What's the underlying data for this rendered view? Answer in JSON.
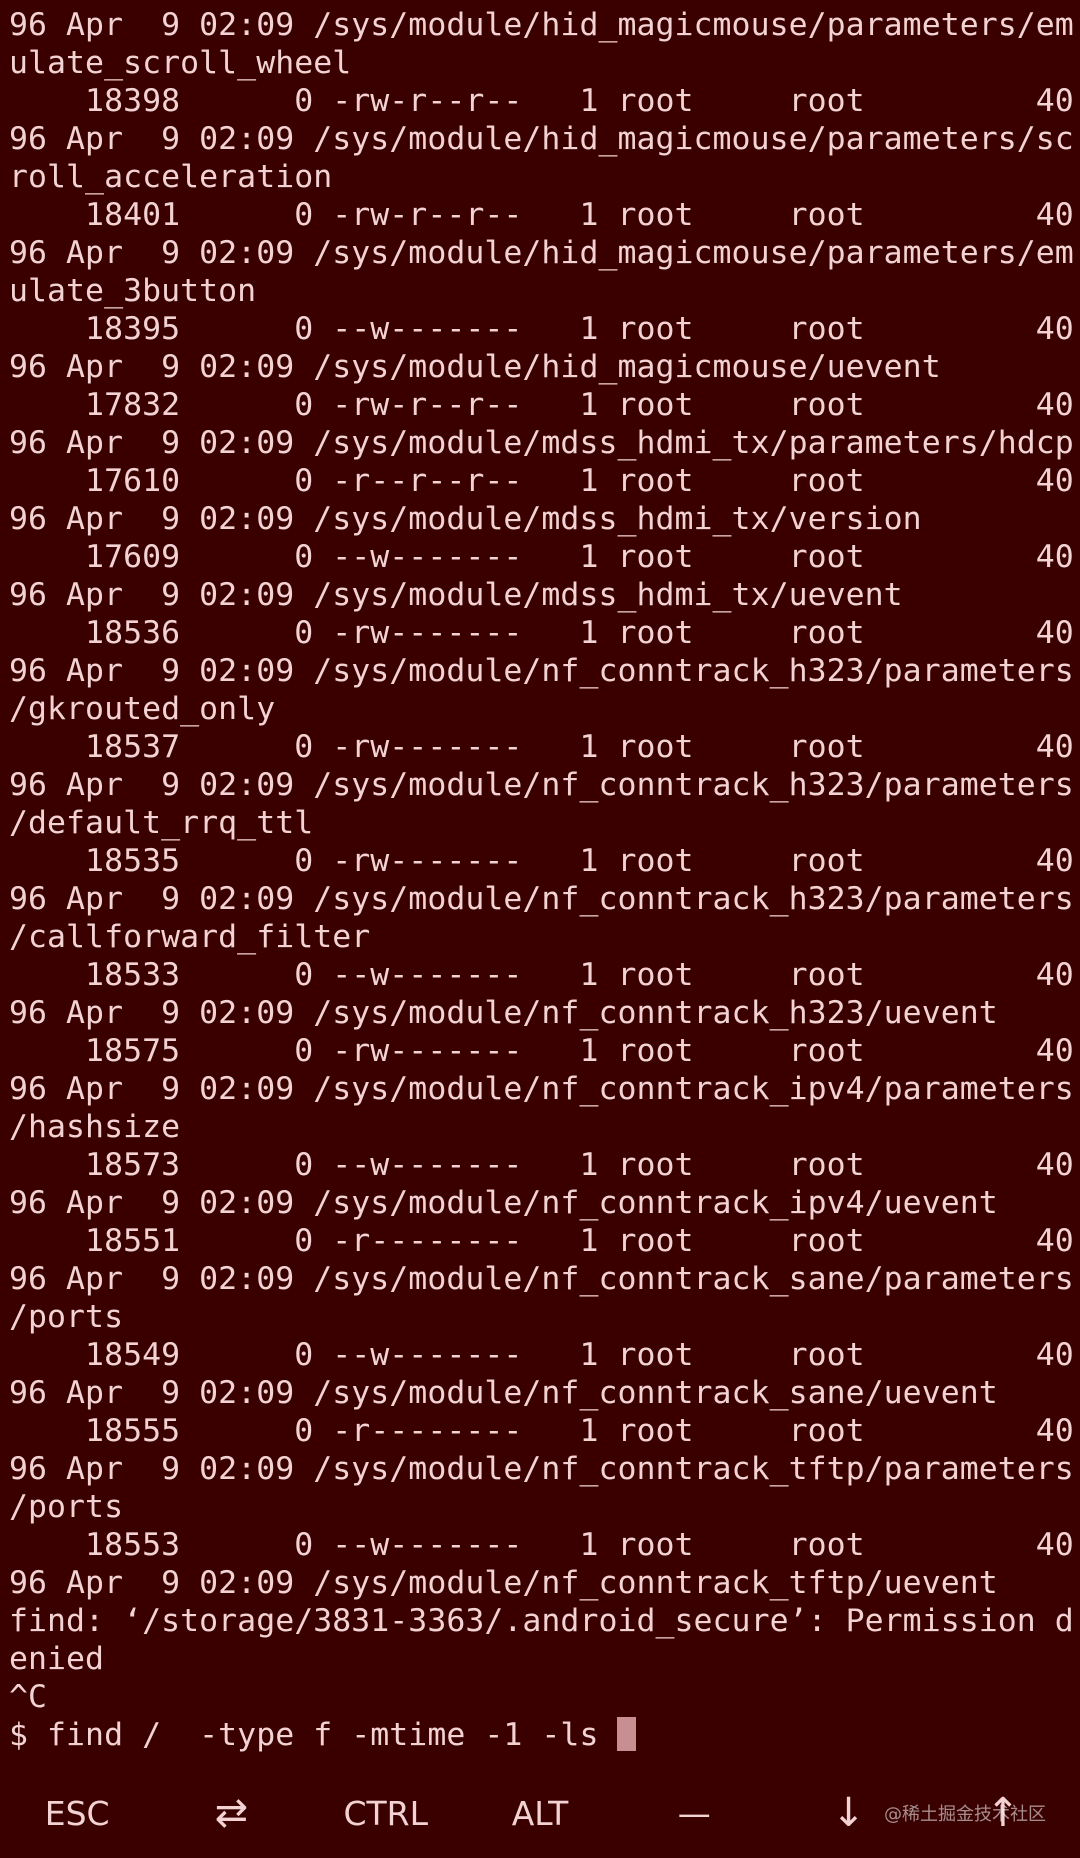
{
  "terminal": {
    "lines": [
      "96 Apr  9 02:09 /sys/module/hid_magicmouse/parameters/em",
      "ulate_scroll_wheel",
      "    18398      0 -rw-r--r--   1 root     root         40",
      "96 Apr  9 02:09 /sys/module/hid_magicmouse/parameters/sc",
      "roll_acceleration",
      "    18401      0 -rw-r--r--   1 root     root         40",
      "96 Apr  9 02:09 /sys/module/hid_magicmouse/parameters/em",
      "ulate_3button",
      "    18395      0 --w-------   1 root     root         40",
      "96 Apr  9 02:09 /sys/module/hid_magicmouse/uevent",
      "    17832      0 -rw-r--r--   1 root     root         40",
      "96 Apr  9 02:09 /sys/module/mdss_hdmi_tx/parameters/hdcp",
      "    17610      0 -r--r--r--   1 root     root         40",
      "96 Apr  9 02:09 /sys/module/mdss_hdmi_tx/version",
      "    17609      0 --w-------   1 root     root         40",
      "96 Apr  9 02:09 /sys/module/mdss_hdmi_tx/uevent",
      "    18536      0 -rw-------   1 root     root         40",
      "96 Apr  9 02:09 /sys/module/nf_conntrack_h323/parameters",
      "/gkrouted_only",
      "    18537      0 -rw-------   1 root     root         40",
      "96 Apr  9 02:09 /sys/module/nf_conntrack_h323/parameters",
      "/default_rrq_ttl",
      "    18535      0 -rw-------   1 root     root         40",
      "96 Apr  9 02:09 /sys/module/nf_conntrack_h323/parameters",
      "/callforward_filter",
      "    18533      0 --w-------   1 root     root         40",
      "96 Apr  9 02:09 /sys/module/nf_conntrack_h323/uevent",
      "    18575      0 -rw-------   1 root     root         40",
      "96 Apr  9 02:09 /sys/module/nf_conntrack_ipv4/parameters",
      "/hashsize",
      "    18573      0 --w-------   1 root     root         40",
      "96 Apr  9 02:09 /sys/module/nf_conntrack_ipv4/uevent",
      "    18551      0 -r--------   1 root     root         40",
      "96 Apr  9 02:09 /sys/module/nf_conntrack_sane/parameters",
      "/ports",
      "    18549      0 --w-------   1 root     root         40",
      "96 Apr  9 02:09 /sys/module/nf_conntrack_sane/uevent",
      "    18555      0 -r--------   1 root     root         40",
      "96 Apr  9 02:09 /sys/module/nf_conntrack_tftp/parameters",
      "/ports",
      "    18553      0 --w-------   1 root     root         40",
      "96 Apr  9 02:09 /sys/module/nf_conntrack_tftp/uevent",
      "find: ‘/storage/3831-3363/.android_secure’: Permission d",
      "enied",
      "^C"
    ],
    "prompt": "$ find /  -type f -mtime -1 -ls "
  },
  "extra_keys": {
    "esc": "ESC",
    "tab": "⇄",
    "ctrl": "CTRL",
    "alt": "ALT",
    "dash": "—",
    "down": "↓",
    "up": "↑"
  },
  "watermark": "@稀土掘金技术社区",
  "colors": {
    "background": "#3a0000",
    "foreground": "#f2d2d2",
    "cursor": "#c88f93"
  }
}
